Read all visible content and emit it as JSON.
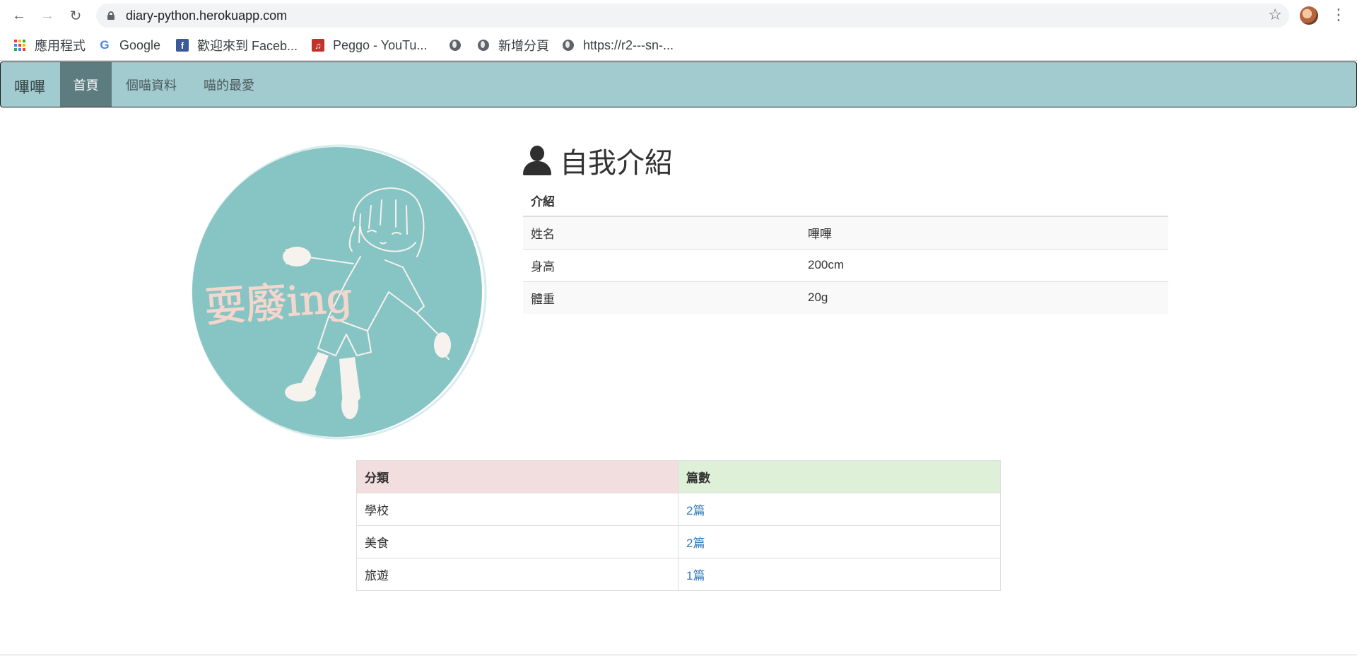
{
  "browser": {
    "url": "diary-python.herokuapp.com",
    "bookmarks": [
      {
        "label": "應用程式",
        "icon": "apps-grid-icon"
      },
      {
        "label": "Google",
        "icon": "google-icon"
      },
      {
        "label": "歡迎來到 Faceb...",
        "icon": "facebook-icon"
      },
      {
        "label": "Peggo - YouTu...",
        "icon": "music-icon"
      },
      {
        "label": "",
        "icon": "globe-icon"
      },
      {
        "label": "新增分頁",
        "icon": "globe-icon"
      },
      {
        "label": "https://r2---sn-...",
        "icon": "globe-icon"
      }
    ]
  },
  "navbar": {
    "brand": "嗶嗶",
    "items": [
      {
        "label": "首頁",
        "active": true
      },
      {
        "label": "個喵資料",
        "active": false
      },
      {
        "label": "喵的最愛",
        "active": false
      }
    ]
  },
  "avatar": {
    "text": "耍廢ing",
    "bg_color": "#87c4c4"
  },
  "intro": {
    "title": "自我介紹",
    "table_header": "介紹",
    "rows": [
      {
        "label": "姓名",
        "value": "嗶嗶"
      },
      {
        "label": "身高",
        "value": "200cm"
      },
      {
        "label": "體重",
        "value": "20g"
      }
    ]
  },
  "categories": {
    "headers": [
      "分類",
      "篇數"
    ],
    "rows": [
      {
        "name": "學校",
        "count": "2篇"
      },
      {
        "name": "美食",
        "count": "2篇"
      },
      {
        "name": "旅遊",
        "count": "1篇"
      }
    ]
  }
}
